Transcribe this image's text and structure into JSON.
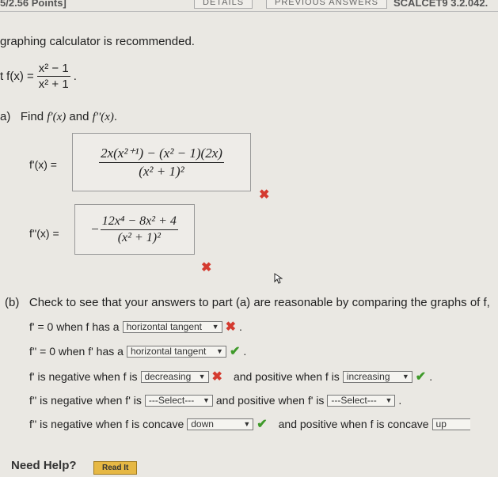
{
  "header": {
    "points": "5/2.56 Points]",
    "details_tab": "DETAILS",
    "previous_tab": "PREVIOUS ANSWERS",
    "problem_id": "SCALCET9 3.2.042."
  },
  "intro": "graphing calculator is recommended.",
  "function": {
    "prefix": "t",
    "lhs": "f(x) =",
    "num": "x² − 1",
    "den": "x² + 1",
    "end": "."
  },
  "part_a": {
    "label": "a)",
    "prompt_pre": "Find ",
    "prompt_f1": "f'(x)",
    "prompt_and": " and ",
    "prompt_f2": "f''(x)",
    "prompt_end": ".",
    "fprime_label": "f'(x) =",
    "fprime_num": "2x(x²⁺¹) − (x² − 1)(2x)",
    "fprime_den": "(x² + 1)²",
    "fprime_status": "✖",
    "fdouble_label": "f''(x) =",
    "fdouble_sign": "−",
    "fdouble_num": "12x⁴ − 8x² + 4",
    "fdouble_den": "(x² + 1)²",
    "fdouble_status": "✖"
  },
  "part_b": {
    "label": "(b)",
    "prompt": "Check to see that your answers to part (a) are reasonable by comparing the graphs of f,",
    "rows": [
      {
        "pre": "f' = 0 when f has a",
        "select": "horizontal tangent",
        "status": "✖",
        "mid": ".",
        "select2": "",
        "status2": "",
        "end": ""
      },
      {
        "pre": "f'' = 0 when f' has a",
        "select": "horizontal tangent",
        "status": "✔",
        "mid": ".",
        "select2": "",
        "status2": "",
        "end": ""
      },
      {
        "pre": "f' is negative when f is",
        "select": "decreasing",
        "status": "✖",
        "mid": "and positive when f is",
        "select2": "increasing",
        "status2": "✔",
        "end": "."
      },
      {
        "pre": "f'' is negative when f' is",
        "select": "---Select---",
        "status": "",
        "mid": "and positive when f' is",
        "select2": "---Select---",
        "status2": "",
        "end": "."
      },
      {
        "pre": "f'' is negative when f is concave",
        "select": "down",
        "status": "✔",
        "mid": "and positive when f is concave",
        "select2": "up",
        "status2": "",
        "end": ""
      }
    ]
  },
  "help": {
    "label": "Need Help?",
    "button": "Read It"
  },
  "colors": {
    "wrong": "#d43a2f",
    "correct": "#3f9a2a",
    "help_button": "#e6b844"
  }
}
